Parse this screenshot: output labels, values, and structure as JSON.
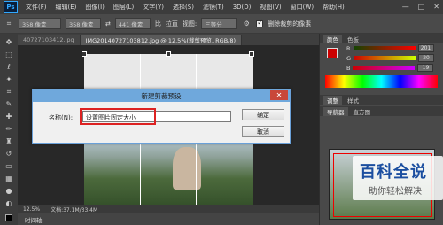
{
  "app": {
    "logo": "Ps"
  },
  "menubar": {
    "items": [
      "文件(F)",
      "编辑(E)",
      "图像(I)",
      "图层(L)",
      "文字(Y)",
      "选择(S)",
      "滤镜(T)",
      "3D(D)",
      "视图(V)",
      "窗口(W)",
      "帮助(H)"
    ],
    "window_controls": [
      "—",
      "□",
      "✕"
    ]
  },
  "options_bar": {
    "width_value": "358 像素",
    "field2": "358 像素",
    "field3": "441 像素",
    "swap": "⇄",
    "ratio_label": "比",
    "straighten_label": "拉直",
    "view_label": "视图:",
    "view_value": "三等分",
    "delete_cropped_label": "删除裁剪的像素"
  },
  "tabs": [
    {
      "label": "40727103412.jpg",
      "active": false
    },
    {
      "label": "IMG20140727103812.jpg @ 12.5%(裁剪预览, RGB/8)",
      "active": true
    }
  ],
  "status": {
    "zoom": "12.5%",
    "doc": "文档:37.1M/33.4M"
  },
  "timeline": {
    "label": "时间轴"
  },
  "right_panel": {
    "tabs1": [
      "颜色",
      "色板"
    ],
    "sliders": [
      {
        "label": "R",
        "value": "201"
      },
      {
        "label": "G",
        "value": "20"
      },
      {
        "label": "B",
        "value": "19"
      }
    ],
    "tabs2": [
      "调整",
      "样式"
    ],
    "tabs3": [
      "导航器",
      "直方图"
    ],
    "colors": {
      "fg": "#c91414"
    }
  },
  "dialog": {
    "title": "新建剪裁预设",
    "name_label": "名称(N):",
    "name_value": "设置图片固定大小",
    "ok": "确定",
    "cancel": "取消",
    "close": "✕"
  },
  "watermark": {
    "main": "百科全说",
    "sub": "助你轻松解决"
  }
}
